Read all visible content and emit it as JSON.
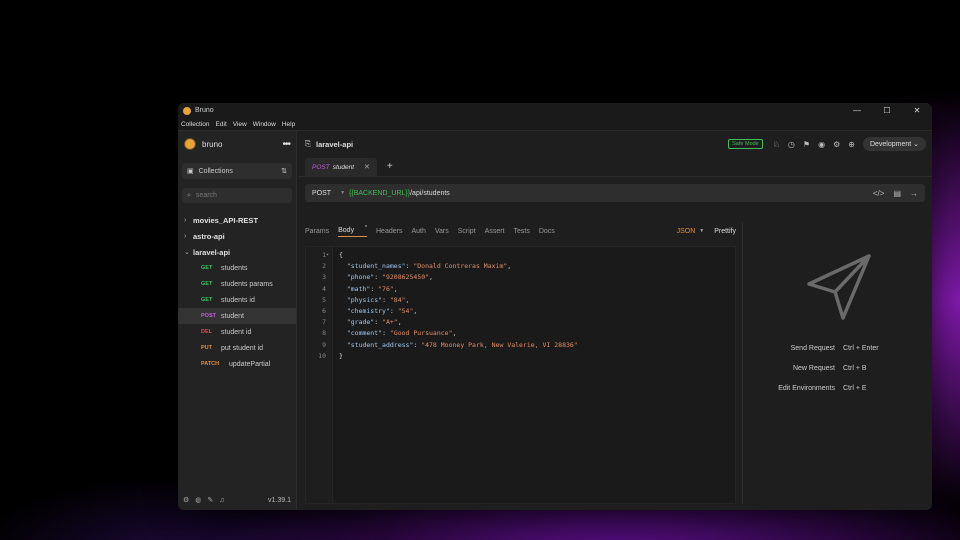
{
  "window": {
    "title": "Bruno",
    "menu": [
      "Collection",
      "Edit",
      "View",
      "Window",
      "Help"
    ],
    "controls": [
      "—",
      "☐",
      "✕"
    ]
  },
  "sidebar": {
    "brand": "bruno",
    "collections_label": "Collections",
    "search_placeholder": "search",
    "collections": [
      {
        "name": "movies_API-REST",
        "expanded": false
      },
      {
        "name": "astro-api",
        "expanded": false
      },
      {
        "name": "laravel-api",
        "expanded": true
      }
    ],
    "requests": [
      {
        "method": "GET",
        "name": "students"
      },
      {
        "method": "GET",
        "name": "students params"
      },
      {
        "method": "GET",
        "name": "students id"
      },
      {
        "method": "POST",
        "name": "student"
      },
      {
        "method": "DEL",
        "name": "student id"
      },
      {
        "method": "PUT",
        "name": "put student id"
      },
      {
        "method": "PATCH",
        "name": "updatePartial"
      }
    ],
    "version": "v1.39.1"
  },
  "header": {
    "collection_title": "laravel-api",
    "safe_mode": "Safe Mode",
    "environment": "Development"
  },
  "tab": {
    "method": "POST",
    "name": "student"
  },
  "request": {
    "method": "POST",
    "url_var": "{{BACKEND_URL}}",
    "url_path": "/api/students",
    "tabs": [
      "Params",
      "Body",
      "Headers",
      "Auth",
      "Vars",
      "Script",
      "Assert",
      "Tests",
      "Docs"
    ],
    "active_tab_marker": "*",
    "body_mode": "JSON",
    "prettify": "Prettify"
  },
  "body": {
    "line_numbers": [
      "1",
      "2",
      "3",
      "4",
      "5",
      "6",
      "7",
      "8",
      "9",
      "10"
    ],
    "open": "{",
    "close": "}",
    "fields": [
      {
        "key": "\"student_names\"",
        "value": "\"Donald Contreras Maxim\""
      },
      {
        "key": "\"phone\"",
        "value": "\"9208625450\""
      },
      {
        "key": "\"math\"",
        "value": "\"76\""
      },
      {
        "key": "\"physics\"",
        "value": "\"84\""
      },
      {
        "key": "\"chemistry\"",
        "value": "\"54\""
      },
      {
        "key": "\"grade\"",
        "value": "\"A+\""
      },
      {
        "key": "\"comment\"",
        "value": "\"Good Pursuance\""
      },
      {
        "key": "\"student_address\"",
        "value": "\"478 Mooney Park, New Valerie, VI 28836\""
      }
    ]
  },
  "shortcuts": [
    {
      "label": "Send Request",
      "keys": "Ctrl + Enter"
    },
    {
      "label": "New Request",
      "keys": "Ctrl + B"
    },
    {
      "label": "Edit Environments",
      "keys": "Ctrl + E"
    }
  ]
}
